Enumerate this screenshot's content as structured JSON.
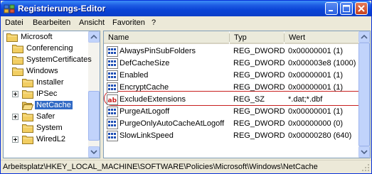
{
  "window": {
    "title": "Registrierungs-Editor",
    "icon": "registry-editor-icon"
  },
  "titlebar_buttons": [
    "minimize-icon",
    "maximize-icon",
    "close-icon"
  ],
  "menu": [
    "Datei",
    "Bearbeiten",
    "Ansicht",
    "Favoriten",
    "?"
  ],
  "tree": {
    "items": [
      {
        "label": "Microsoft",
        "level": 0,
        "expander": "none",
        "selected": false
      },
      {
        "label": "Conferencing",
        "level": 1,
        "expander": "none",
        "selected": false
      },
      {
        "label": "SystemCertificates",
        "level": 1,
        "expander": "none",
        "selected": false
      },
      {
        "label": "Windows",
        "level": 1,
        "expander": "none",
        "selected": false
      },
      {
        "label": "Installer",
        "level": 2,
        "expander": "none",
        "selected": false
      },
      {
        "label": "IPSec",
        "level": 2,
        "expander": "plus",
        "selected": false
      },
      {
        "label": "NetCache",
        "level": 2,
        "expander": "none",
        "selected": true
      },
      {
        "label": "Safer",
        "level": 2,
        "expander": "plus",
        "selected": false
      },
      {
        "label": "System",
        "level": 2,
        "expander": "none",
        "selected": false
      },
      {
        "label": "WiredL2",
        "level": 2,
        "expander": "plus",
        "selected": false
      }
    ]
  },
  "list": {
    "columns": [
      "Name",
      "Typ",
      "Wert"
    ],
    "rows": [
      {
        "name": "AlwaysPinSubFolders",
        "type": "REG_DWORD",
        "value": "0x00000001 (1)",
        "icon": "dword-value-icon"
      },
      {
        "name": "DefCacheSize",
        "type": "REG_DWORD",
        "value": "0x000003e8 (1000)",
        "icon": "dword-value-icon"
      },
      {
        "name": "Enabled",
        "type": "REG_DWORD",
        "value": "0x00000001 (1)",
        "icon": "dword-value-icon"
      },
      {
        "name": "EncryptCache",
        "type": "REG_DWORD",
        "value": "0x00000001 (1)",
        "icon": "dword-value-icon"
      },
      {
        "name": "ExcludeExtensions",
        "type": "REG_SZ",
        "value": "*.dat;*.dbf",
        "icon": "string-value-icon"
      },
      {
        "name": "PurgeAtLogoff",
        "type": "REG_DWORD",
        "value": "0x00000001 (1)",
        "icon": "dword-value-icon"
      },
      {
        "name": "PurgeOnlyAutoCacheAtLogoff",
        "type": "REG_DWORD",
        "value": "0x00000000 (0)",
        "icon": "dword-value-icon"
      },
      {
        "name": "SlowLinkSpeed",
        "type": "REG_DWORD",
        "value": "0x00000280 (640)",
        "icon": "dword-value-icon"
      }
    ],
    "highlighted_row": "ExcludeExtensions",
    "highlight_color": "#C8201F"
  },
  "status": {
    "path": "Arbeitsplatz\\HKEY_LOCAL_MACHINE\\SOFTWARE\\Policies\\Microsoft\\Windows\\NetCache"
  },
  "colors": {
    "titlebar": "#0A43D6",
    "selection": "#316AC5",
    "dword_icon": "#1F4FB5",
    "string_icon": "#C8201F"
  }
}
